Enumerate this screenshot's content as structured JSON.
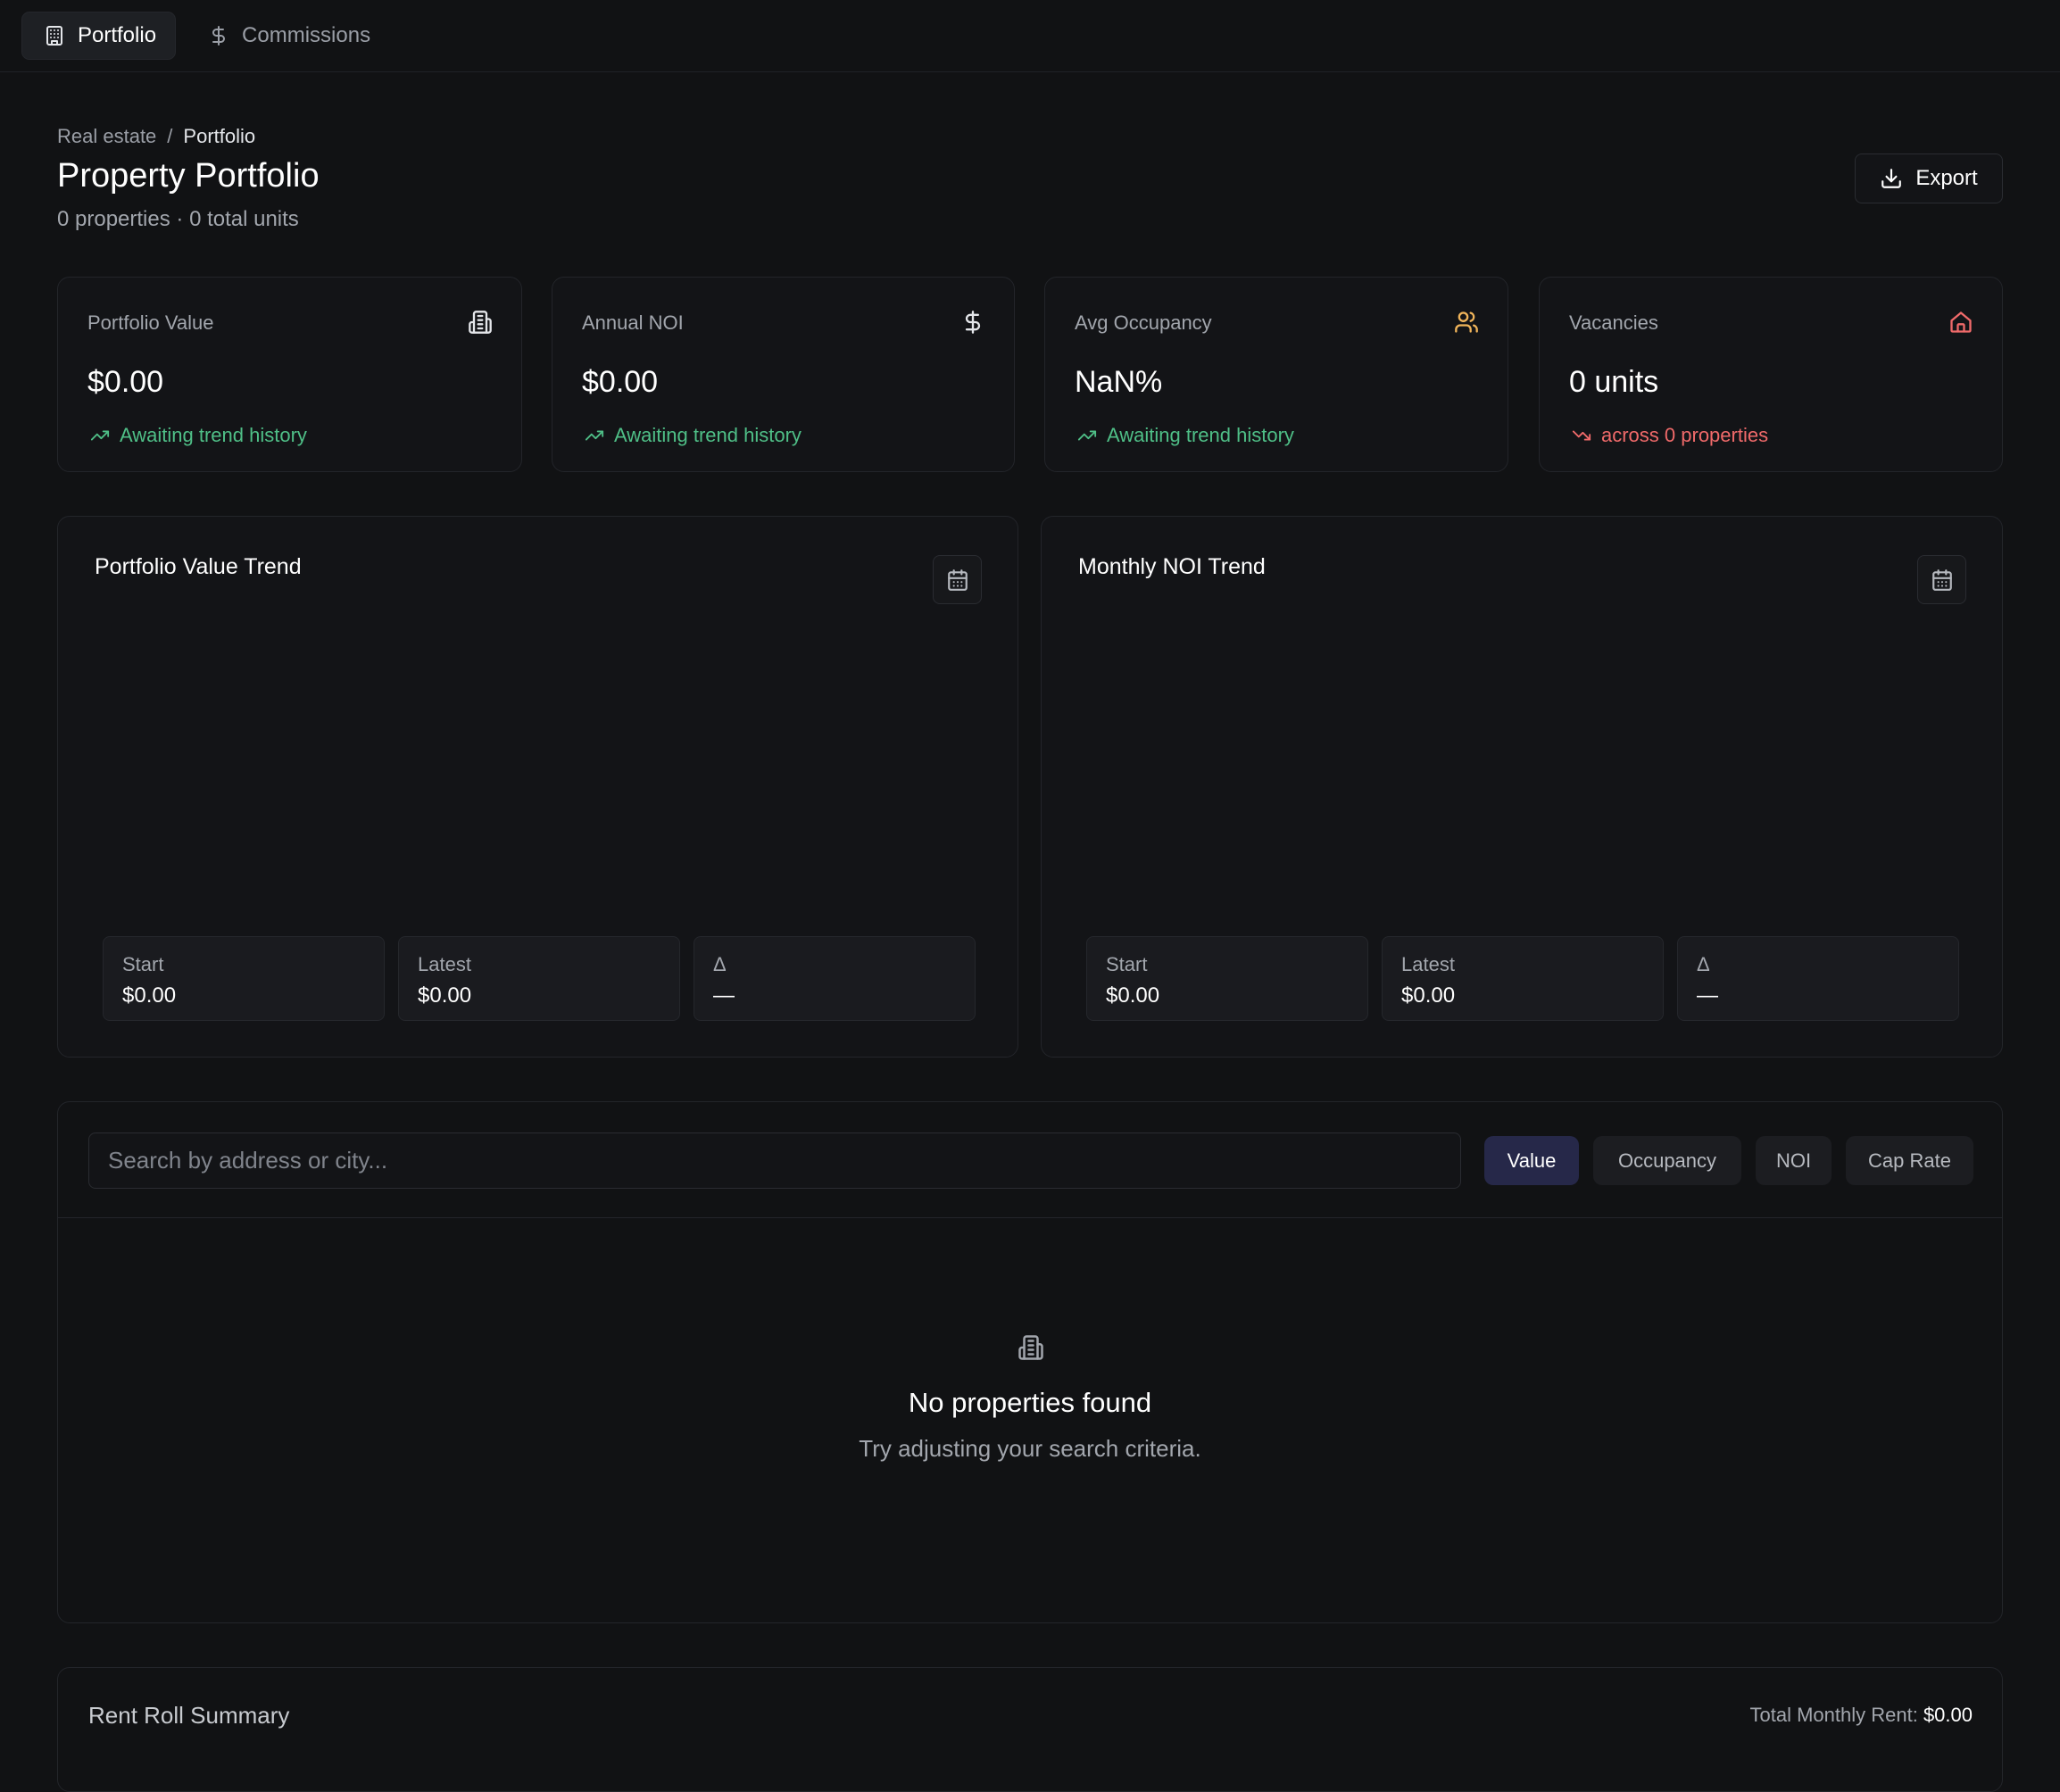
{
  "nav": {
    "tabs": [
      {
        "label": "Portfolio",
        "icon": "building-icon"
      },
      {
        "label": "Commissions",
        "icon": "dollar-icon"
      }
    ]
  },
  "header": {
    "breadcrumb": {
      "parent": "Real estate",
      "separator": "/",
      "current": "Portfolio"
    },
    "title": "Property Portfolio",
    "subtitle": "0 properties · 0 total units",
    "export_label": "Export"
  },
  "stats": [
    {
      "label": "Portfolio Value",
      "value": "$0.00",
      "trend": "Awaiting trend history",
      "icon": "building-icon",
      "icon_color": "#e4e6ea",
      "trend_dir": "up"
    },
    {
      "label": "Annual NOI",
      "value": "$0.00",
      "trend": "Awaiting trend history",
      "icon": "dollar-icon",
      "icon_color": "#e4e6ea",
      "trend_dir": "up"
    },
    {
      "label": "Avg Occupancy",
      "value": "NaN%",
      "trend": "Awaiting trend history",
      "icon": "users-icon",
      "icon_color": "#f0b45a",
      "trend_dir": "up"
    },
    {
      "label": "Vacancies",
      "value": "0 units",
      "trend": "across 0 properties",
      "icon": "home-icon",
      "icon_color": "#f06a6a",
      "trend_dir": "down"
    }
  ],
  "trends": [
    {
      "title": "Portfolio Value Trend",
      "start_label": "Start",
      "start": "$0.00",
      "latest_label": "Latest",
      "latest": "$0.00",
      "delta_label": "Δ",
      "delta": "—"
    },
    {
      "title": "Monthly NOI Trend",
      "start_label": "Start",
      "start": "$0.00",
      "latest_label": "Latest",
      "latest": "$0.00",
      "delta_label": "Δ",
      "delta": "—"
    }
  ],
  "properties": {
    "search_placeholder": "Search by address or city...",
    "sort_options": [
      {
        "label": "Value",
        "active": true
      },
      {
        "label": "Occupancy",
        "active": false
      },
      {
        "label": "NOI",
        "active": false
      },
      {
        "label": "Cap Rate",
        "active": false
      }
    ],
    "empty_title": "No properties found",
    "empty_subtitle": "Try adjusting your search criteria."
  },
  "rent_roll": {
    "title": "Rent Roll Summary",
    "total_label": "Total Monthly Rent:",
    "total_value": "$0.00"
  },
  "colors": {
    "background": "#111214",
    "positive": "#4fbf87",
    "negative": "#f06a6a",
    "accent": "#262849"
  }
}
